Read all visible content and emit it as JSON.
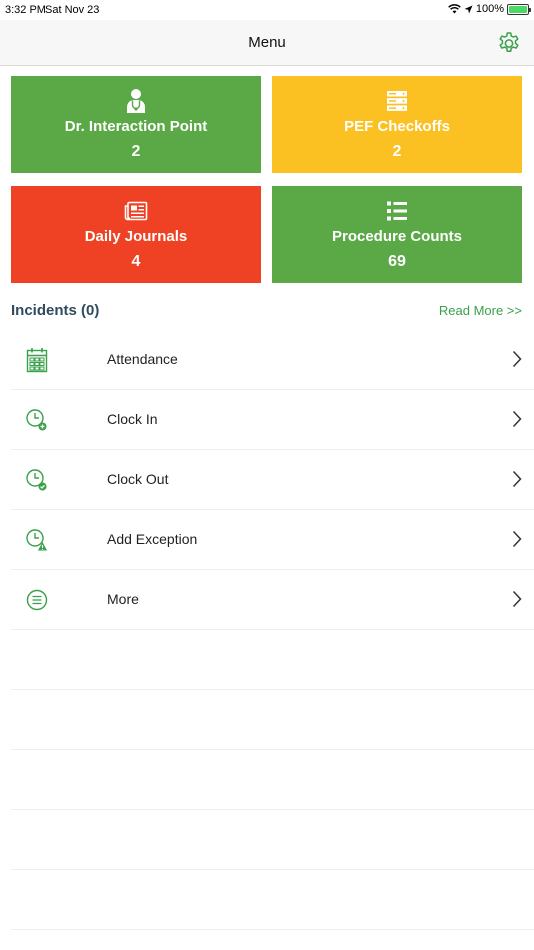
{
  "status_bar": {
    "time": "3:32 PM",
    "date": "Sat Nov 23",
    "battery": "100%"
  },
  "header": {
    "title": "Menu",
    "settings_icon": "gear-icon"
  },
  "tiles": [
    {
      "label": "Dr. Interaction Point",
      "count": "2",
      "color": "#5ba847",
      "icon": "doctor-icon"
    },
    {
      "label": "PEF Checkoffs",
      "count": "2",
      "color": "#fbc022",
      "icon": "server-icon"
    },
    {
      "label": "Daily Journals",
      "count": "4",
      "color": "#ef4123",
      "icon": "newspaper-icon"
    },
    {
      "label": "Procedure Counts",
      "count": "69",
      "color": "#5ba847",
      "icon": "list-icon"
    }
  ],
  "incidents": {
    "title": "Incidents (0)",
    "read_more": "Read More >>"
  },
  "menu": [
    {
      "label": "Attendance",
      "icon": "calendar-icon"
    },
    {
      "label": "Clock In",
      "icon": "clock-plus-icon"
    },
    {
      "label": "Clock Out",
      "icon": "clock-check-icon"
    },
    {
      "label": "Add Exception",
      "icon": "clock-warning-icon"
    },
    {
      "label": "More",
      "icon": "menu-lines-icon"
    }
  ],
  "colors": {
    "accent": "#3aa04a",
    "green_tile": "#5ba847",
    "yellow_tile": "#fbc022",
    "red_tile": "#ef4123",
    "incidents_title": "#2f4b5e"
  }
}
